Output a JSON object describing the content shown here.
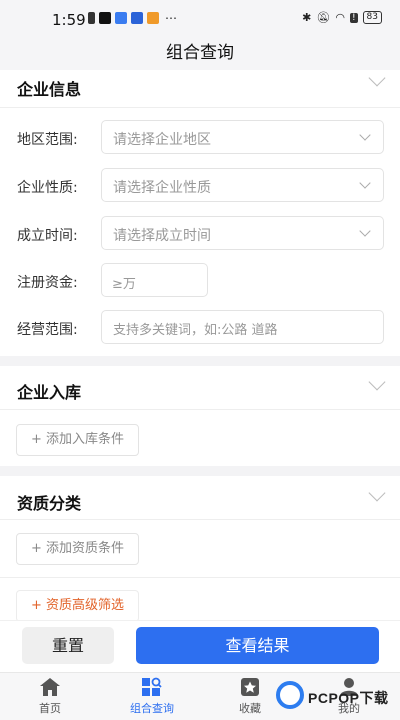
{
  "status_bar": {
    "time": "1:59",
    "battery": "83",
    "left_icons": [
      "sim-icon",
      "tiktok-icon",
      "cloud-icon",
      "browser-icon",
      "video-icon"
    ],
    "more": "⋯"
  },
  "header": {
    "title": "组合查询"
  },
  "sections": {
    "company_info": {
      "title": "企业信息",
      "fields": [
        {
          "label": "地区范围:",
          "placeholder": "请选择企业地区"
        },
        {
          "label": "企业性质:",
          "placeholder": "请选择企业性质"
        },
        {
          "label": "成立时间:",
          "placeholder": "请选择成立时间"
        },
        {
          "label": "注册资金:",
          "placeholder": "≥万"
        },
        {
          "label": "经营范围:",
          "placeholder": "支持多关键词，如:公路 道路"
        }
      ]
    },
    "warehousing": {
      "title": "企业入库",
      "add_label": "+ 添加入库条件"
    },
    "qualification": {
      "title": "资质分类",
      "add_label": "+ 添加资质条件",
      "advanced_label": "+ 资质高级筛选"
    }
  },
  "actions": {
    "reset": "重置",
    "view_results": "查看结果"
  },
  "tabs": [
    {
      "label": "首页",
      "icon": "home-icon"
    },
    {
      "label": "组合查询",
      "icon": "combo-query-icon",
      "active": true
    },
    {
      "label": "收藏",
      "icon": "favorite-icon"
    },
    {
      "label": "我的",
      "icon": "profile-icon"
    }
  ],
  "watermark": {
    "text": "PCPOP下载"
  },
  "colors": {
    "accent": "#2d6ff0",
    "orange": "#e2632a"
  }
}
